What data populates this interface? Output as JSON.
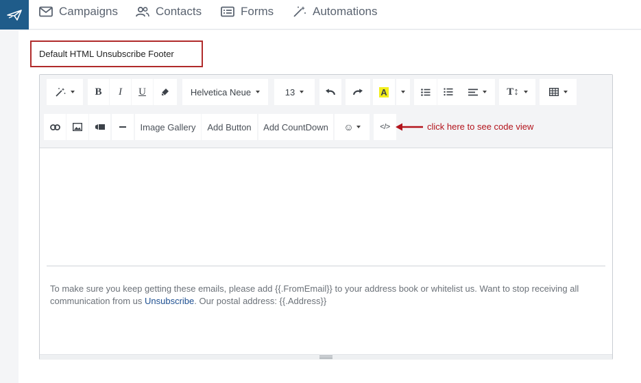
{
  "nav": {
    "items": [
      {
        "label": "Campaigns",
        "icon": "envelope-icon"
      },
      {
        "label": "Contacts",
        "icon": "people-icon"
      },
      {
        "label": "Forms",
        "icon": "form-icon"
      },
      {
        "label": "Automations",
        "icon": "magic-wand-icon"
      }
    ]
  },
  "page": {
    "title": "Default HTML Unsubscribe Footer"
  },
  "toolbar": {
    "font_family": "Helvetica Neue",
    "font_size": "13",
    "image_gallery": "Image Gallery",
    "add_button": "Add Button",
    "add_countdown": "Add CountDown",
    "code_view_label": "</>"
  },
  "annotation": {
    "text": "click here to see code view"
  },
  "editor": {
    "text_before_link": "To make sure you keep getting these emails, please add {{.FromEmail}} to your address book or whitelist us. Want to stop receiving all communication from us ",
    "link_text": "Unsubscribe",
    "text_after_link": ". Our postal address: {{.Address}}"
  },
  "colors": {
    "brand": "#1f5c8a",
    "highlight_box": "#b02a2a",
    "annotation": "#b3131b",
    "link": "#1d4f91"
  }
}
